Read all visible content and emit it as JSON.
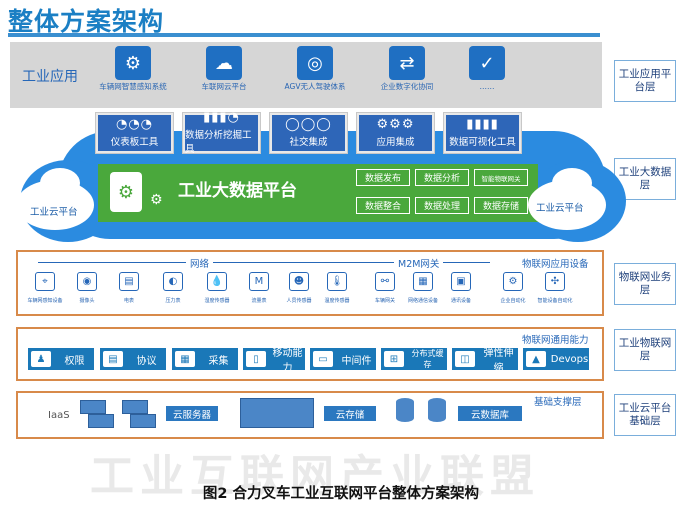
{
  "title": "整体方案架构",
  "layers": [
    "工业应用平台层",
    "工业大数据层",
    "物联网业务层",
    "工业物联网层",
    "工业云平台基础层"
  ],
  "app": {
    "label": "工业应用",
    "items": [
      {
        "label": "车辆网智慧感知系统",
        "icon": "network-icon",
        "glyph": "⚙"
      },
      {
        "label": "车联网云平台",
        "icon": "cloud-upload-icon",
        "glyph": "☁"
      },
      {
        "label": "AGV无人驾驶体系",
        "icon": "steering-wheel-icon",
        "glyph": "◎"
      },
      {
        "label": "企业数字化协同",
        "icon": "toggle-icon",
        "glyph": "⇄"
      },
      {
        "label": "……",
        "icon": "check-icon",
        "glyph": "✓"
      }
    ]
  },
  "tools": [
    {
      "label": "仪表板工具",
      "icon": "dashboard-icon",
      "glyph": "◔◔◔"
    },
    {
      "label": "数据分析挖掘工具",
      "icon": "analysis-icon",
      "glyph": "▮▮▮◔"
    },
    {
      "label": "社交集成",
      "icon": "chat-icon",
      "glyph": "◯◯◯"
    },
    {
      "label": "应用集成",
      "icon": "gear-icon",
      "glyph": "⚙⚙⚙"
    },
    {
      "label": "数据可视化工具",
      "icon": "chart-icon",
      "glyph": "▮▮▮▮"
    }
  ],
  "bigdata": {
    "title": "工业大数据平台",
    "cloud_left": "工业云平台",
    "cloud_right": "工业云平台",
    "functions": [
      "数据发布",
      "数据分析",
      "智能物联网关",
      "数据整合",
      "数据处理",
      "数据存储"
    ]
  },
  "iot_business": {
    "network_label": "网络",
    "m2m_label": "M2M网关",
    "app_device_label": "物联网应用设备",
    "devices": [
      {
        "label": "车辆网感知设备",
        "icon": "map-icon",
        "glyph": "⌖"
      },
      {
        "label": "摄像头",
        "icon": "camera-icon",
        "glyph": "◉"
      },
      {
        "label": "电表",
        "icon": "meter-icon",
        "glyph": "▤"
      },
      {
        "label": "压力表",
        "icon": "gauge-icon",
        "glyph": "◐"
      },
      {
        "label": "湿度传感器",
        "icon": "humidity-icon",
        "glyph": "💧"
      },
      {
        "label": "流量表",
        "icon": "flow-meter-icon",
        "glyph": "M"
      },
      {
        "label": "人员传感器",
        "icon": "person-icon",
        "glyph": "☻"
      },
      {
        "label": "温度传感器",
        "icon": "thermometer-icon",
        "glyph": "🌡"
      },
      {
        "label": "车辆网关",
        "icon": "car-icon",
        "glyph": "⚯"
      },
      {
        "label": "网络通信设备",
        "icon": "grid-icon",
        "glyph": "▦"
      },
      {
        "label": "通讯设备",
        "icon": "device-icon",
        "glyph": "▣"
      },
      {
        "label": "企业自动化",
        "icon": "automation-icon",
        "glyph": "⚙"
      },
      {
        "label": "智能设备自动化",
        "icon": "smart-device-icon",
        "glyph": "✣"
      }
    ]
  },
  "iot_general": {
    "label": "物联网通用能力",
    "capabilities": [
      {
        "label": "权限",
        "icon": "user-icon",
        "glyph": "♟"
      },
      {
        "label": "协议",
        "icon": "protocol-icon",
        "glyph": "▤"
      },
      {
        "label": "采集",
        "icon": "collect-icon",
        "glyph": "▦"
      },
      {
        "label": "移动能力",
        "icon": "mobile-icon",
        "glyph": "▯"
      },
      {
        "label": "中间件",
        "icon": "middleware-icon",
        "glyph": "▭"
      },
      {
        "label": "分布式缓存",
        "icon": "cache-icon",
        "glyph": "⊞"
      },
      {
        "label": "弹性伸缩",
        "icon": "scale-icon",
        "glyph": "◫"
      },
      {
        "label": "Devops",
        "icon": "devops-icon",
        "glyph": "▲"
      }
    ]
  },
  "infra": {
    "label": "基础支撑层",
    "iaas": "IaaS",
    "server": "云服务器",
    "storage": "云存储",
    "database": "云数据库"
  },
  "watermark": "工业互联网产业联盟",
  "caption": "图2 合力叉车工业互联网平台整体方案架构"
}
